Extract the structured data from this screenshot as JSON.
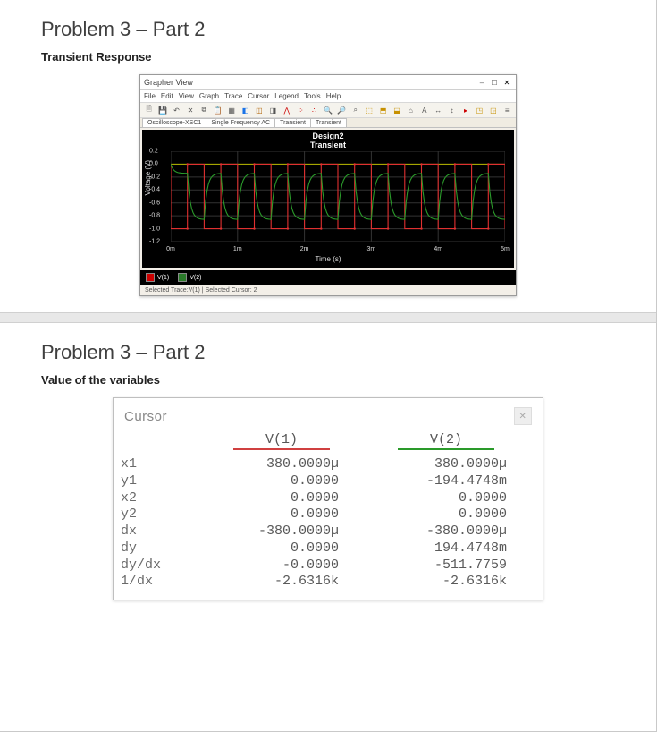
{
  "slide1": {
    "title": "Problem 3 – Part 2",
    "subtitle": "Transient Response",
    "window": {
      "title": "Grapher View",
      "menus": [
        "File",
        "Edit",
        "View",
        "Graph",
        "Trace",
        "Cursor",
        "Legend",
        "Tools",
        "Help"
      ],
      "tabs": [
        "Oscilloscope-XSC1",
        "Single Frequency AC",
        "Transient",
        "Transient"
      ],
      "plot_title": "Design2",
      "plot_sub": "Transient",
      "xlabel": "Time (s)",
      "ylabel": "Voltage (V)",
      "legend": [
        {
          "name": "V(1)",
          "color": "#e03030"
        },
        {
          "name": "V(2)",
          "color": "#2a9a2a"
        }
      ],
      "status": "Selected Trace:V(1)   |   Selected Cursor: 2"
    }
  },
  "slide2": {
    "title": "Problem 3 – Part 2",
    "subtitle": "Value of the variables",
    "cursor": {
      "title": "Cursor",
      "columns": [
        "",
        "V(1)",
        "V(2)"
      ],
      "rows": [
        {
          "label": "x1",
          "v1": "380.0000µ",
          "v2": "380.0000µ"
        },
        {
          "label": "y1",
          "v1": "0.0000",
          "v2": "-194.4748m"
        },
        {
          "label": "x2",
          "v1": "0.0000",
          "v2": "0.0000"
        },
        {
          "label": "y2",
          "v1": "0.0000",
          "v2": "0.0000"
        },
        {
          "label": "dx",
          "v1": "-380.0000µ",
          "v2": "-380.0000µ"
        },
        {
          "label": "dy",
          "v1": "0.0000",
          "v2": "194.4748m"
        },
        {
          "label": "dy/dx",
          "v1": "-0.0000",
          "v2": "-511.7759"
        },
        {
          "label": "1/dx",
          "v1": "-2.6316k",
          "v2": "-2.6316k"
        }
      ]
    }
  },
  "chart_data": {
    "type": "line",
    "title": "Design2",
    "subtitle": "Transient",
    "xlabel": "Time (s)",
    "ylabel": "Voltage (V)",
    "xlim": [
      0,
      0.005
    ],
    "ylim": [
      -1.2,
      0.2
    ],
    "xticks": [
      "0m",
      "1m",
      "2m",
      "3m",
      "4m",
      "5m"
    ],
    "yticks": [
      0.2,
      0.0,
      -0.2,
      -0.4,
      -0.6,
      -0.8,
      -1.0,
      -1.2
    ],
    "series": [
      {
        "name": "V(1)",
        "color": "#e03030",
        "type": "square",
        "period_ms": 0.5,
        "low": -1.0,
        "high": 0.0
      },
      {
        "name": "V(2)",
        "color": "#2a9a2a",
        "type": "decay_filtered",
        "approx_points": [
          {
            "t_ms": 0,
            "v": 0.0
          },
          {
            "t_ms": 0.38,
            "v": -0.19
          },
          {
            "t_ms": 1,
            "v": -0.45
          },
          {
            "t_ms": 2,
            "v": -0.48
          },
          {
            "t_ms": 3,
            "v": -0.5
          },
          {
            "t_ms": 4,
            "v": -0.5
          },
          {
            "t_ms": 5,
            "v": -0.51
          }
        ]
      }
    ]
  }
}
